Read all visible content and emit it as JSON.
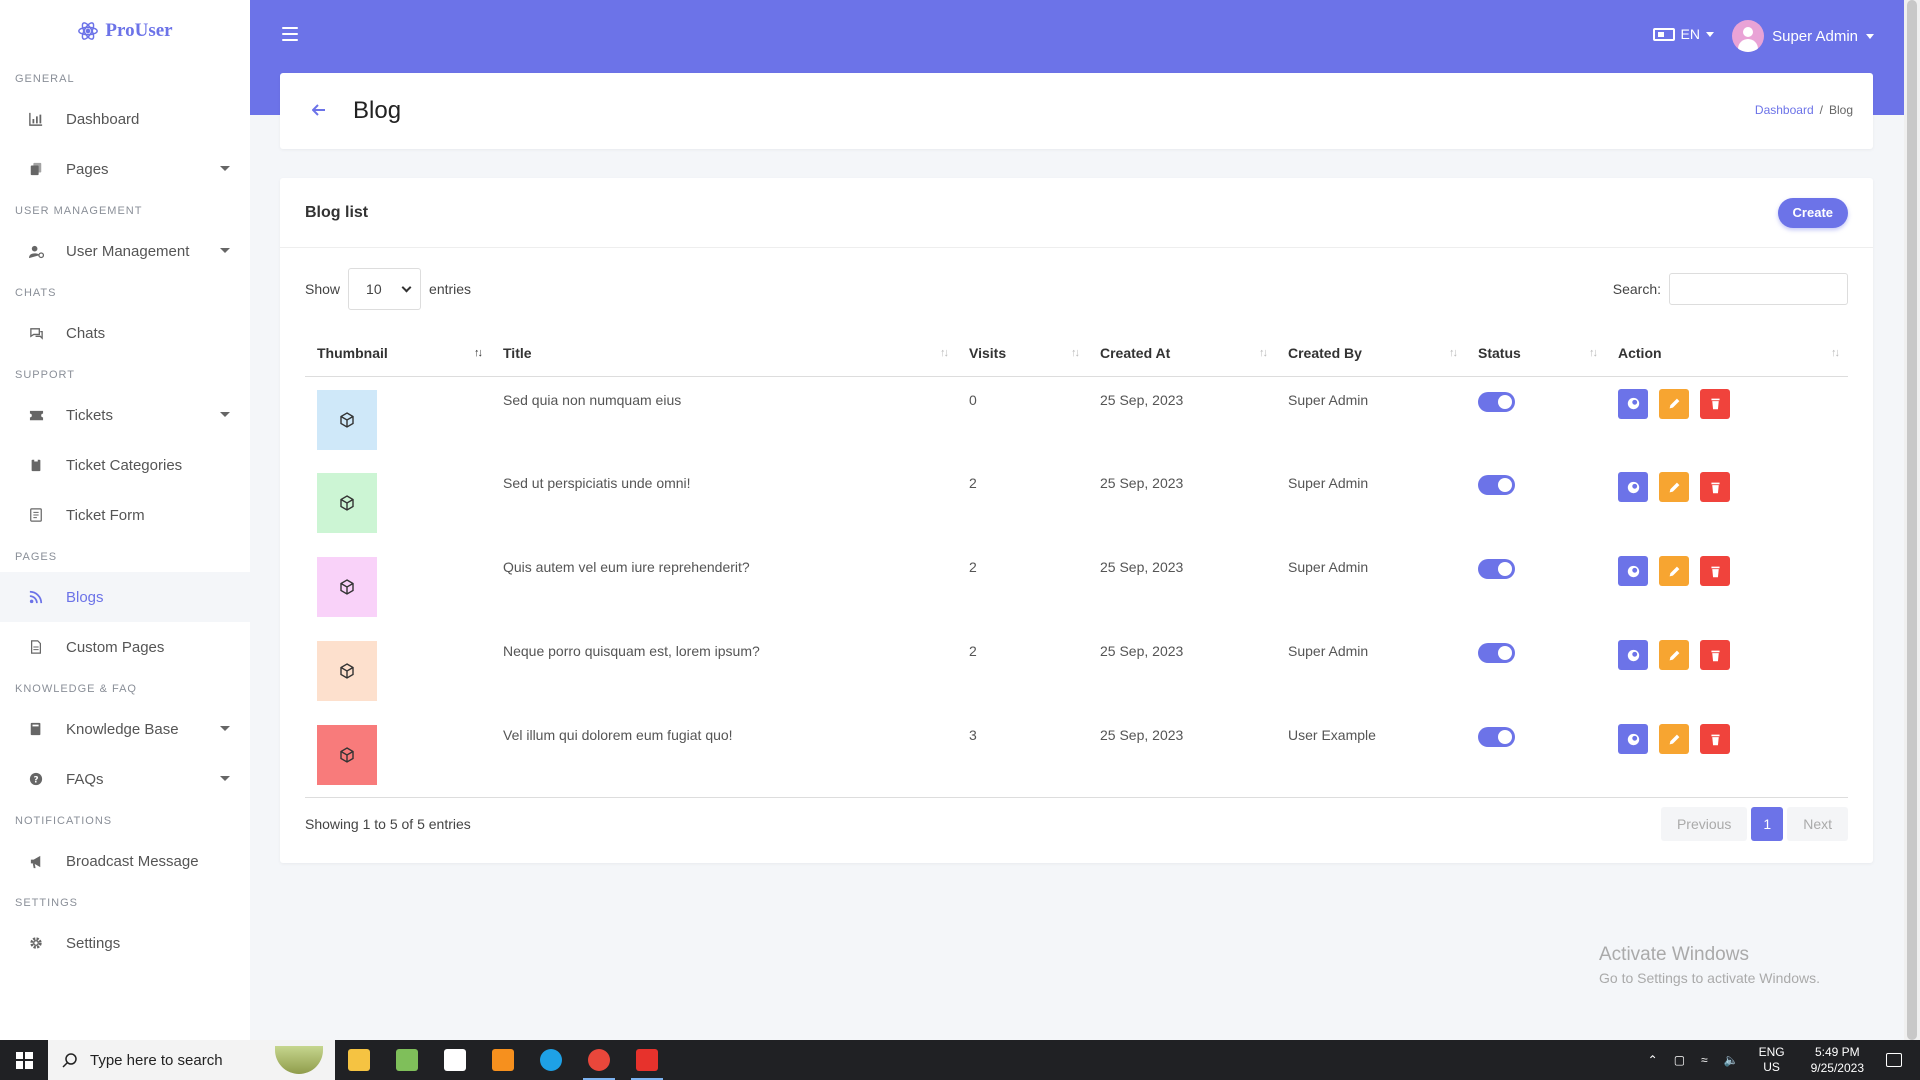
{
  "brand": {
    "name": "ProUser",
    "icon": "atom-icon"
  },
  "sidebar": {
    "sections": [
      {
        "title": "GENERAL",
        "items": [
          {
            "label": "Dashboard",
            "icon": "chart-icon",
            "caret": false,
            "active": false
          },
          {
            "label": "Pages",
            "icon": "copy-icon",
            "caret": true,
            "active": false
          }
        ]
      },
      {
        "title": "USER MANAGEMENT",
        "items": [
          {
            "label": "User Management",
            "icon": "user-gear-icon",
            "caret": true,
            "active": false
          }
        ]
      },
      {
        "title": "CHATS",
        "items": [
          {
            "label": "Chats",
            "icon": "chat-icon",
            "caret": false,
            "active": false
          }
        ]
      },
      {
        "title": "SUPPORT",
        "items": [
          {
            "label": "Tickets",
            "icon": "ticket-icon",
            "caret": true,
            "active": false
          },
          {
            "label": "Ticket Categories",
            "icon": "clipboard-icon",
            "caret": false,
            "active": false
          },
          {
            "label": "Ticket Form",
            "icon": "form-icon",
            "caret": false,
            "active": false
          }
        ]
      },
      {
        "title": "PAGES",
        "items": [
          {
            "label": "Blogs",
            "icon": "rss-icon",
            "caret": false,
            "active": true
          },
          {
            "label": "Custom Pages",
            "icon": "file-icon",
            "caret": false,
            "active": false
          }
        ]
      },
      {
        "title": "KNOWLEDGE & FAQ",
        "items": [
          {
            "label": "Knowledge Base",
            "icon": "book-icon",
            "caret": true,
            "active": false
          },
          {
            "label": "FAQs",
            "icon": "question-icon",
            "caret": true,
            "active": false
          }
        ]
      },
      {
        "title": "NOTIFICATIONS",
        "items": [
          {
            "label": "Broadcast Message",
            "icon": "megaphone-icon",
            "caret": false,
            "active": false
          }
        ]
      },
      {
        "title": "SETTINGS",
        "items": [
          {
            "label": "Settings",
            "icon": "gear-icon",
            "caret": false,
            "active": false
          }
        ]
      }
    ]
  },
  "topbar": {
    "language": "EN",
    "user_name": "Super Admin"
  },
  "header": {
    "title": "Blog",
    "breadcrumb": {
      "home": "Dashboard",
      "current": "Blog"
    }
  },
  "list": {
    "title": "Blog list",
    "create_label": "Create",
    "show_label": "Show",
    "entries_value": "10",
    "entries_label": "entries",
    "search_label": "Search:",
    "search_value": "",
    "columns": [
      "Thumbnail",
      "Title",
      "Visits",
      "Created At",
      "Created By",
      "Status",
      "Action"
    ],
    "rows": [
      {
        "thumb_color": "#cfe8f9",
        "title": "Sed quia non numquam eius",
        "visits": "0",
        "created_at": "25 Sep, 2023",
        "created_by": "Super Admin",
        "status": true
      },
      {
        "thumb_color": "#ccf5d4",
        "title": "Sed ut perspiciatis unde omni!",
        "visits": "2",
        "created_at": "25 Sep, 2023",
        "created_by": "Super Admin",
        "status": true
      },
      {
        "thumb_color": "#f9d2f9",
        "title": "Quis autem vel eum iure reprehenderit?",
        "visits": "2",
        "created_at": "25 Sep, 2023",
        "created_by": "Super Admin",
        "status": true
      },
      {
        "thumb_color": "#fde0cd",
        "title": "Neque porro quisquam est, lorem ipsum?",
        "visits": "2",
        "created_at": "25 Sep, 2023",
        "created_by": "Super Admin",
        "status": true
      },
      {
        "thumb_color": "#f87b7b",
        "title": "Vel illum qui dolorem eum fugiat quo!",
        "visits": "3",
        "created_at": "25 Sep, 2023",
        "created_by": "User Example",
        "status": true
      }
    ],
    "info": "Showing 1 to 5 of 5 entries",
    "pagination": {
      "previous": "Previous",
      "current": "1",
      "next": "Next"
    }
  },
  "watermark": {
    "line1": "Activate Windows",
    "line2": "Go to Settings to activate Windows."
  },
  "taskbar": {
    "search_placeholder": "Type here to search",
    "apps": [
      {
        "name": "file-explorer-icon",
        "color": "#f5c342",
        "active": false
      },
      {
        "name": "notepad-icon",
        "color": "#7fbf5a",
        "active": false
      },
      {
        "name": "slack-icon",
        "color": "#ffffff",
        "active": false
      },
      {
        "name": "sublime-icon",
        "color": "#f6901e",
        "active": false
      },
      {
        "name": "skype-icon",
        "color": "#1ea1e6",
        "active": false
      },
      {
        "name": "chrome-icon",
        "color": "#e9473b",
        "active": true
      },
      {
        "name": "anydesk-icon",
        "color": "#e7322c",
        "active": true
      }
    ],
    "tray_lang": "ENG",
    "tray_region": "US",
    "time": "5:49 PM",
    "date": "9/25/2023"
  },
  "colors": {
    "accent": "#6c73e8",
    "edit": "#f7a531",
    "delete": "#f0433c"
  }
}
